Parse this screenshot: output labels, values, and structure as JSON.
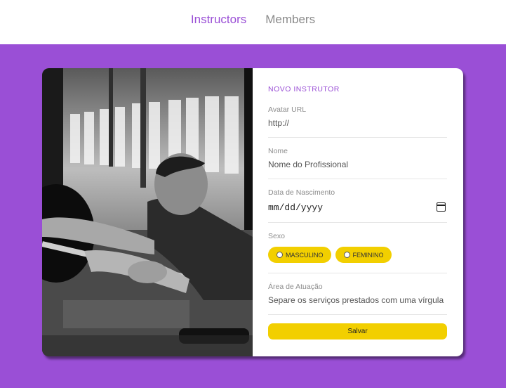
{
  "nav": {
    "instructors": "Instructors",
    "members": "Members"
  },
  "form": {
    "title": "NOVO INSTRUTOR",
    "avatar": {
      "label": "Avatar URL",
      "placeholder": "http://"
    },
    "nome": {
      "label": "Nome",
      "placeholder": "Nome do Profissional"
    },
    "data": {
      "label": "Data de Nascimento",
      "value": "mm/dd/yyyy"
    },
    "sexo": {
      "label": "Sexo",
      "options": [
        "MASCULINO",
        "FEMININO"
      ]
    },
    "area": {
      "label": "Área de Atuação",
      "placeholder": "Separe os serviços prestados com uma vírgula"
    },
    "save_label": "Salvar"
  },
  "colors": {
    "accent": "#9a4fd6",
    "button": "#f2cf00"
  },
  "photo": {
    "icon": "gym-photo"
  }
}
